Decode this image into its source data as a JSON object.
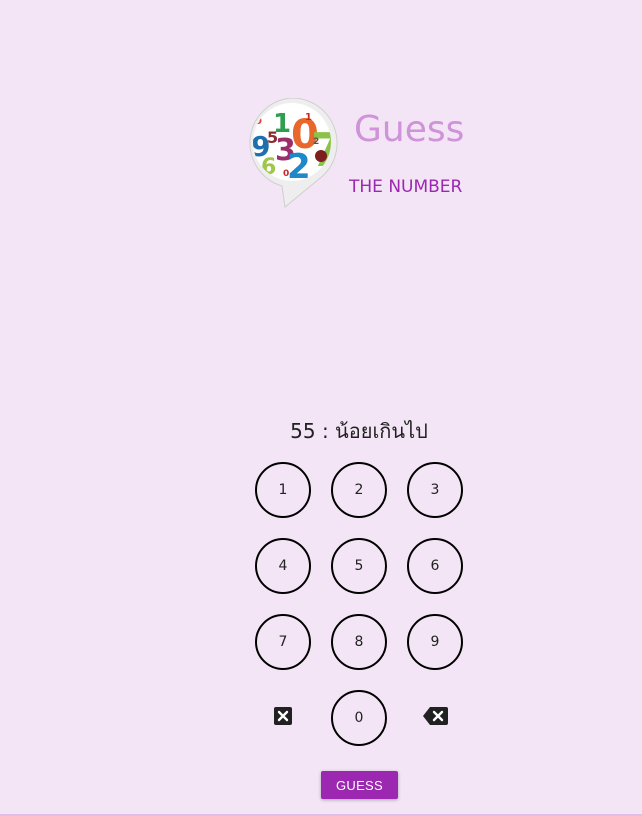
{
  "header": {
    "title": "Guess",
    "subtitle": "THE NUMBER",
    "logo_icon": "number-bubble-logo-icon"
  },
  "feedback": {
    "text": "55 : น้อยเกินไป"
  },
  "keypad": {
    "keys": [
      "1",
      "2",
      "3",
      "4",
      "5",
      "6",
      "7",
      "8",
      "9",
      "0"
    ],
    "clear_icon": "clear-icon",
    "backspace_icon": "backspace-icon"
  },
  "actions": {
    "guess_label": "GUESS"
  },
  "colors": {
    "background": "#f3e5f5",
    "title": "#ce93d8",
    "accent": "#9c27b0"
  }
}
